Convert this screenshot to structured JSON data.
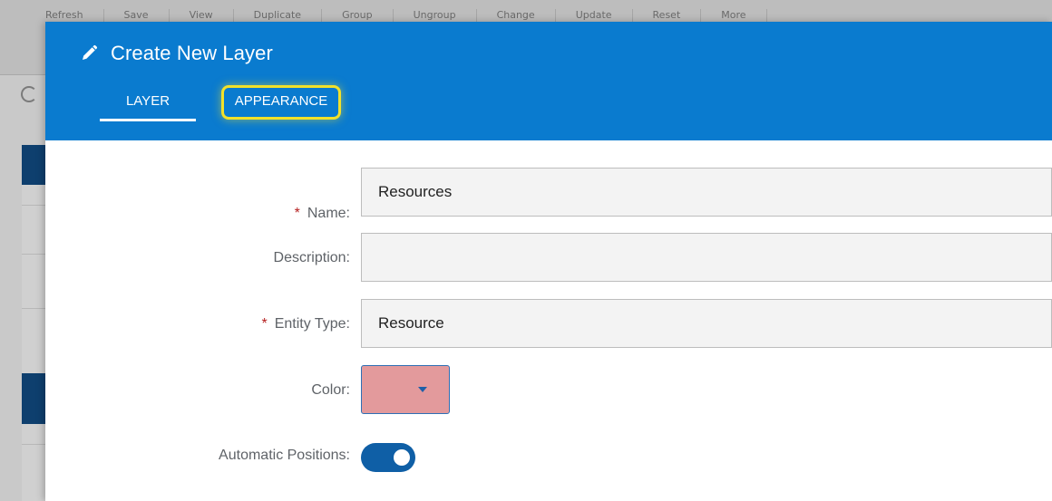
{
  "background": {
    "toolbar_items": [
      "Refresh",
      "Save",
      "View",
      "Duplicate",
      "Group",
      "Ungroup",
      "Change",
      "Update",
      "Reset",
      "More"
    ]
  },
  "dialog": {
    "title": "Create New Layer",
    "title_icon": "pencil-icon",
    "header_color": "#0a7bcf",
    "tabs": [
      {
        "label": "LAYER",
        "active": true
      },
      {
        "label": "APPEARANCE",
        "active": false,
        "highlighted": true
      }
    ],
    "highlight_color": "#f2e12a"
  },
  "form": {
    "name": {
      "label": "Name:",
      "required": "*",
      "value": "Resources"
    },
    "description": {
      "label": "Description:",
      "value": ""
    },
    "entity_type": {
      "label": "Entity Type:",
      "required": "*",
      "value": "Resource"
    },
    "color": {
      "label": "Color:",
      "swatch": "#e39a9c",
      "icon": "chevron-down-icon"
    },
    "automatic_positions": {
      "label": "Automatic Positions:",
      "enabled": true
    }
  }
}
